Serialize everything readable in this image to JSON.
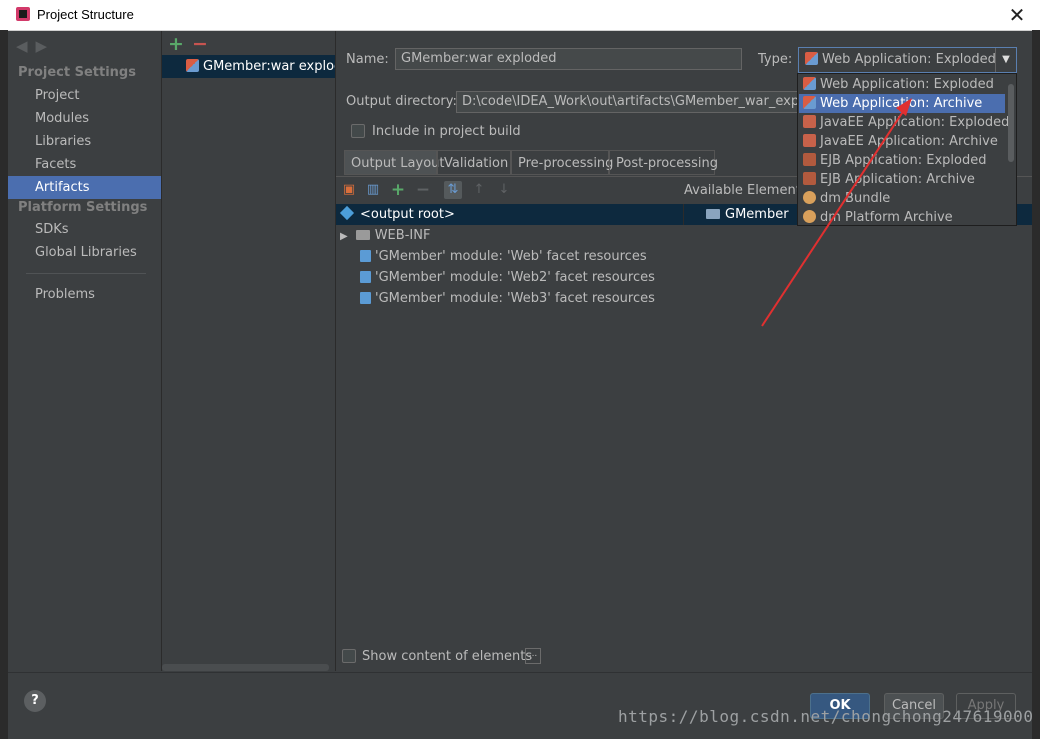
{
  "window": {
    "title": "Project Structure",
    "close": "✕"
  },
  "sidebar": {
    "sections": [
      {
        "label": "Project Settings"
      },
      {
        "label": "Platform Settings"
      }
    ],
    "items": [
      {
        "label": "Project"
      },
      {
        "label": "Modules"
      },
      {
        "label": "Libraries"
      },
      {
        "label": "Facets"
      },
      {
        "label": "Artifacts"
      },
      {
        "label": "SDKs"
      },
      {
        "label": "Global Libraries"
      },
      {
        "label": "Problems"
      }
    ]
  },
  "artifacts": {
    "add": "+",
    "remove": "−",
    "selected": "GMember:war exploded"
  },
  "form": {
    "name_label": "Name:",
    "name_value": "GMember:war exploded",
    "type_label": "Type:",
    "type_value": "Web Application: Exploded",
    "output_label": "Output directory:",
    "output_value": "D:\\code\\IDEA_Work\\out\\artifacts\\GMember_war_exploded",
    "include_label": "Include in project build"
  },
  "tabs": [
    "Output Layout",
    "Validation",
    "Pre-processing",
    "Post-processing"
  ],
  "layout": {
    "available_elements": "Available Elements",
    "root": "<output root>",
    "module": "GMember",
    "tree": [
      "WEB-INF",
      "'GMember' module: 'Web' facet resources",
      "'GMember' module: 'Web2' facet resources",
      "'GMember' module: 'Web3' facet resources"
    ],
    "show_content": "Show content of elements",
    "more": "..."
  },
  "dropdown": {
    "items": [
      "Web Application: Exploded",
      "Web Application: Archive",
      "JavaEE Application: Exploded",
      "JavaEE Application: Archive",
      "EJB Application: Exploded",
      "EJB Application: Archive",
      "dm Bundle",
      "dm Platform Archive"
    ],
    "selected_index": 1
  },
  "buttons": {
    "help": "?",
    "ok": "OK",
    "cancel": "Cancel",
    "apply": "Apply"
  },
  "watermark": "https://blog.csdn.net/chongchong247619000",
  "colors": {
    "accent": "#4b6eaf",
    "arrow": "#e03030",
    "add": "#59a869",
    "remove": "#c75450"
  }
}
